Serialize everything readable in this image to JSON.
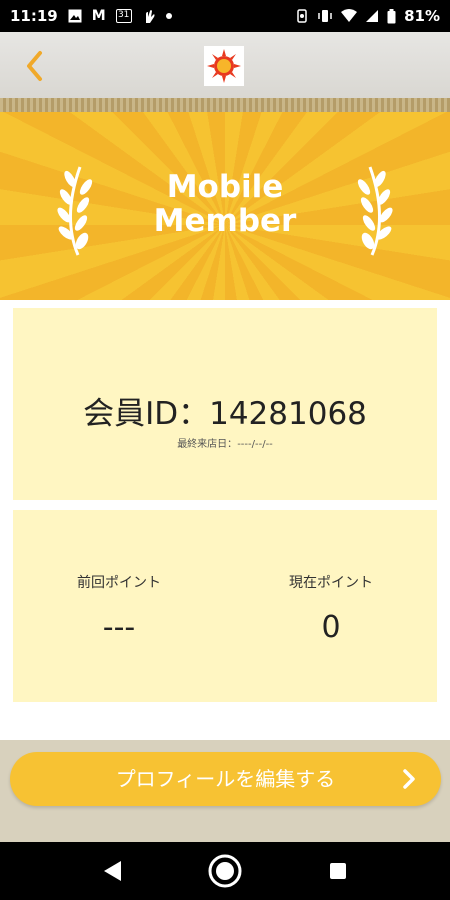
{
  "status_bar": {
    "time": "11:19",
    "calendar_day": "31",
    "battery": "81%"
  },
  "header": {
    "back_icon": "chevron-left-icon",
    "logo_icon": "sun-logo-icon"
  },
  "banner": {
    "title_line1": "Mobile",
    "title_line2": "Member"
  },
  "member": {
    "id_label": "会員ID：",
    "id_value": "14281068",
    "last_visit_label": "最終来店日：",
    "last_visit_value": "----/--/--"
  },
  "points": {
    "previous_label": "前回ポイント",
    "previous_value": "---",
    "current_label": "現在ポイント",
    "current_value": "0"
  },
  "edit_profile": {
    "label": "プロフィールを編集する"
  },
  "colors": {
    "accent": "#f7c233",
    "card_bg": "#fff6c2",
    "back_chevron": "#f0a92a"
  }
}
